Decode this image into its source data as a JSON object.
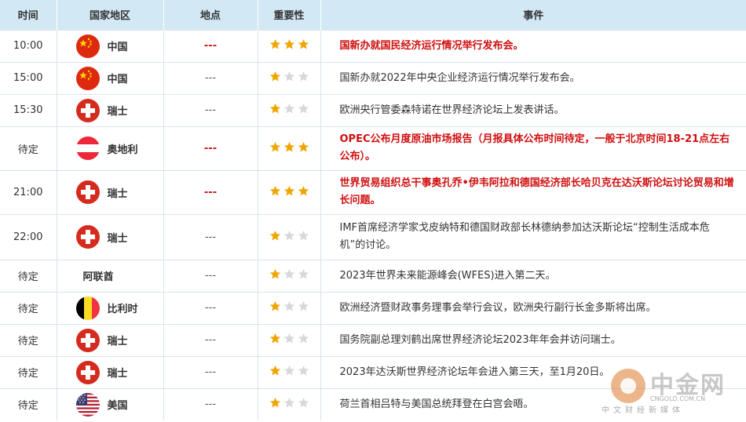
{
  "header": {
    "time": "时间",
    "country": "国家地区",
    "place": "地点",
    "importance": "重要性",
    "event": "事件"
  },
  "rows": [
    {
      "time": "10:00",
      "flag": "china",
      "country": "中国",
      "place": "---",
      "stars": 3,
      "event": "国新办就国民经济运行情况举行发布会。",
      "highlight": true
    },
    {
      "time": "15:00",
      "flag": "china",
      "country": "中国",
      "place": "---",
      "stars": 1,
      "event": "国新办就2022年中央企业经济运行情况举行发布会。",
      "highlight": false
    },
    {
      "time": "15:30",
      "flag": "switzerland",
      "country": "瑞士",
      "place": "---",
      "stars": 1,
      "event": "欧洲央行管委森特诺在世界经济论坛上发表讲话。",
      "highlight": false
    },
    {
      "time": "待定",
      "flag": "austria",
      "country": "奥地利",
      "place": "---",
      "stars": 3,
      "event": "OPEC公布月度原油市场报告（月报具体公布时间待定，一般于北京时间18-21点左右公布）。",
      "highlight": true
    },
    {
      "time": "21:00",
      "flag": "switzerland",
      "country": "瑞士",
      "place": "---",
      "stars": 3,
      "event": "世界贸易组织总干事奥孔乔•伊韦阿拉和德国经济部长哈贝克在达沃斯论坛讨论贸易和增长问题。",
      "highlight": true
    },
    {
      "time": "22:00",
      "flag": "switzerland",
      "country": "瑞士",
      "place": "---",
      "stars": 1,
      "event": "IMF首席经济学家戈皮纳特和德国财政部长林德纳参加达沃斯论坛“控制生活成本危机”的讨论。",
      "highlight": false
    },
    {
      "time": "待定",
      "flag": "none",
      "country": "阿联酋",
      "place": "---",
      "stars": 1,
      "event": "2023年世界未来能源峰会(WFES)进入第二天。",
      "highlight": false
    },
    {
      "time": "待定",
      "flag": "belgium",
      "country": "比利时",
      "place": "---",
      "stars": 1,
      "event": "欧洲经济暨财政事务理事会举行会议，欧洲央行副行长金多斯将出席。",
      "highlight": false
    },
    {
      "time": "待定",
      "flag": "switzerland",
      "country": "瑞士",
      "place": "---",
      "stars": 1,
      "event": "国务院副总理刘鹤出席世界经济论坛2023年年会并访问瑞士。",
      "highlight": false
    },
    {
      "time": "待定",
      "flag": "switzerland",
      "country": "瑞士",
      "place": "---",
      "stars": 1,
      "event": "2023年达沃斯世界经济论坛年会进入第三天，至1月20日。",
      "highlight": false
    },
    {
      "time": "待定",
      "flag": "usa",
      "country": "美国",
      "place": "---",
      "stars": 1,
      "event": "荷兰首相吕特与美国总统拜登在白宫会晤。",
      "highlight": false
    }
  ],
  "watermark": {
    "name": "中金网",
    "url": "CNGOLD.COM.CN",
    "tagline": "中文财经新媒体"
  },
  "colors": {
    "header_bg": "#d3e8f5",
    "highlight_text": "#d01010",
    "star_on": "#f0a500",
    "star_off": "#d8d8d8"
  }
}
